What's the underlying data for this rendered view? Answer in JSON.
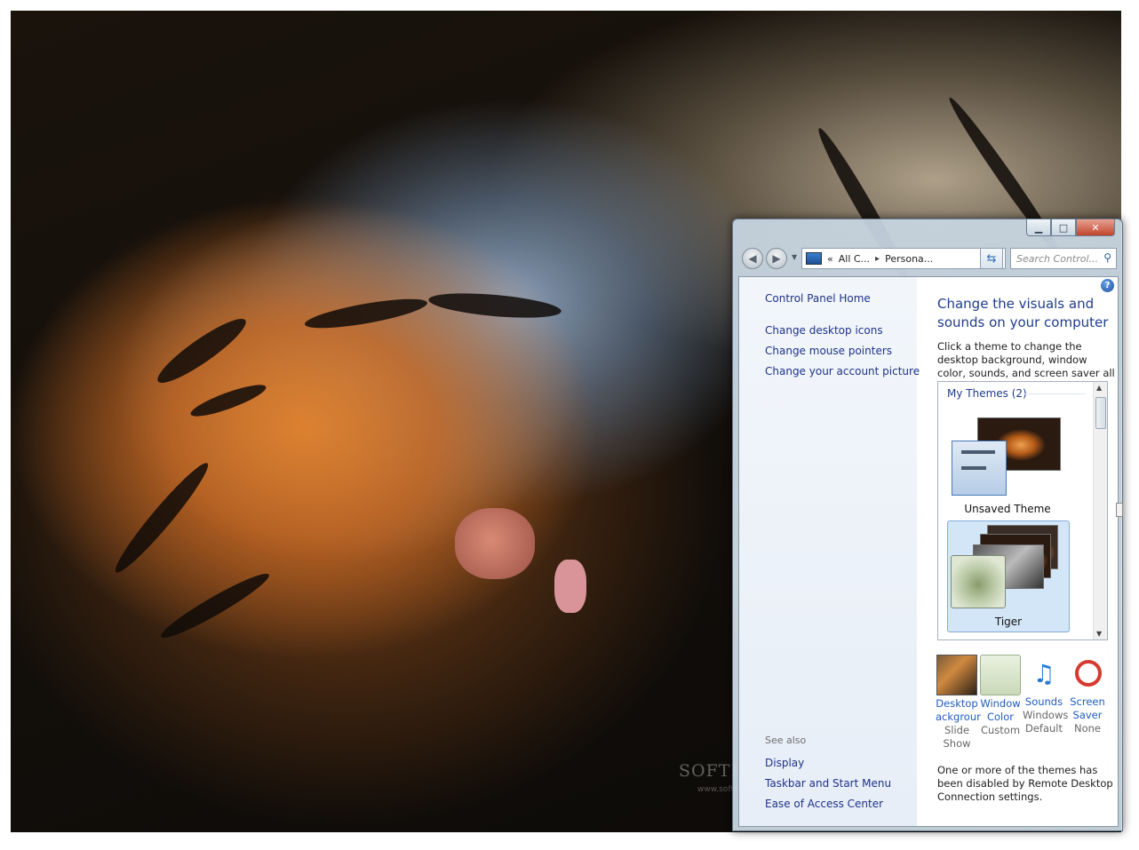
{
  "watermark": {
    "brand": "SOFTPEDIA",
    "url": "www.softpedia.com"
  },
  "window": {
    "caption": {
      "min": "▁",
      "max": "□",
      "close": "✕"
    },
    "nav": {
      "back_icon": "back-arrow-icon",
      "forward_icon": "forward-arrow-icon"
    },
    "breadcrumb": {
      "overflow": "«",
      "crumb1": "All C...",
      "sep": "▸",
      "crumb2": "Persona..."
    },
    "search": {
      "placeholder": "Search Control..."
    },
    "left": {
      "home": "Control Panel Home",
      "links": [
        "Change desktop icons",
        "Change mouse pointers",
        "Change your account picture"
      ],
      "see_also": "See also",
      "see_also_links": [
        "Display",
        "Taskbar and Start Menu",
        "Ease of Access Center"
      ]
    },
    "main": {
      "title": "Change the visuals and sounds on your computer",
      "description": "Click a theme to change the desktop background, window color, sounds, and screen saver all at once.",
      "group_header": "My Themes (2)",
      "themes": [
        {
          "name": "Unsaved Theme",
          "selected": false
        },
        {
          "name": "Tiger",
          "selected": true
        }
      ],
      "customize": [
        {
          "label1": "Desktop",
          "label2": "ackgrour",
          "value1": "Slide",
          "value2": "Show"
        },
        {
          "label1": "Window",
          "label2": "Color",
          "value1": "Custom",
          "value2": ""
        },
        {
          "label1": "Sounds",
          "label2": "",
          "value1": "Windows",
          "value2": "Default"
        },
        {
          "label1": "Screen",
          "label2": "Saver",
          "value1": "None",
          "value2": ""
        }
      ],
      "notice": "One or more of the themes has been disabled by Remote Desktop Connection settings."
    },
    "colors": {
      "link": "#1e3287",
      "accent_title": "#1e3c8c",
      "selected_bg": "#d3e6f8"
    }
  }
}
